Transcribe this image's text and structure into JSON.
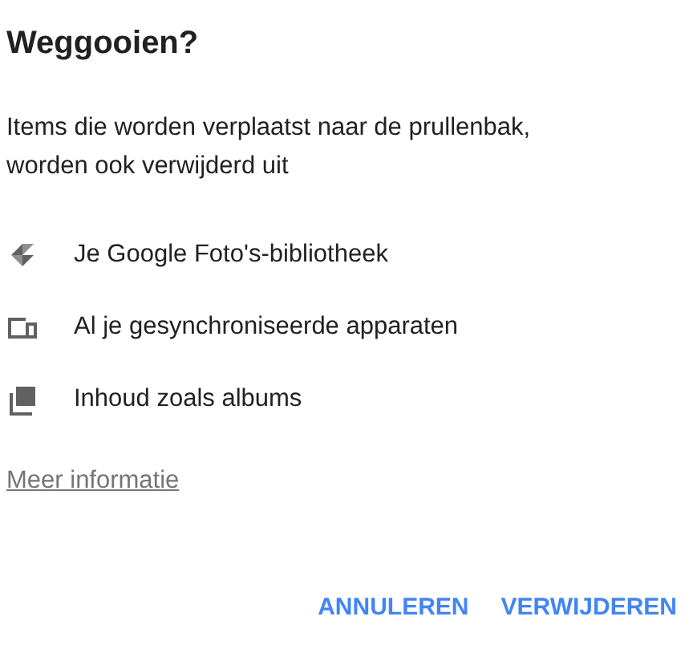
{
  "title": "Weggooien?",
  "message": "Items die worden verplaatst naar de prullenbak, worden ook verwijderd uit",
  "items": [
    {
      "kind": "photos",
      "label": "Je Google Foto's-bibliotheek"
    },
    {
      "kind": "devices",
      "label": "Al je gesynchroniseerde apparaten"
    },
    {
      "kind": "albums",
      "label": "Inhoud zoals albums"
    }
  ],
  "link": "Meer informatie",
  "buttons": [
    "ANNULEREN",
    "VERWIJDEREN"
  ]
}
